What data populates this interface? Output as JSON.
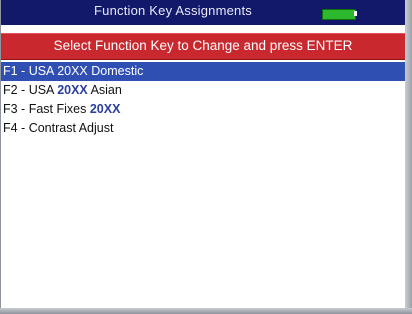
{
  "title_bar": {
    "title": "Function Key Assignments",
    "battery_level": "full",
    "battery_color": "#2eb82e"
  },
  "instruction": {
    "text": "Select Function Key to Change and press ENTER",
    "color": "#c8282e"
  },
  "function_keys": [
    {
      "prefix": "F1 - USA ",
      "highlight": "20XX",
      "suffix": " Domestic",
      "selected": true
    },
    {
      "prefix": "F2 - USA ",
      "highlight": "20XX",
      "suffix": " Asian",
      "selected": false
    },
    {
      "prefix": "F3 - Fast Fixes ",
      "highlight": "20XX",
      "suffix": "",
      "selected": false
    },
    {
      "prefix": "F4 - Contrast Adjust",
      "highlight": "",
      "suffix": "",
      "selected": false
    }
  ],
  "colors": {
    "title_bar_bg": "#12186a",
    "selection_bg": "#2f4fb3",
    "highlight_text": "#2b3da0"
  }
}
